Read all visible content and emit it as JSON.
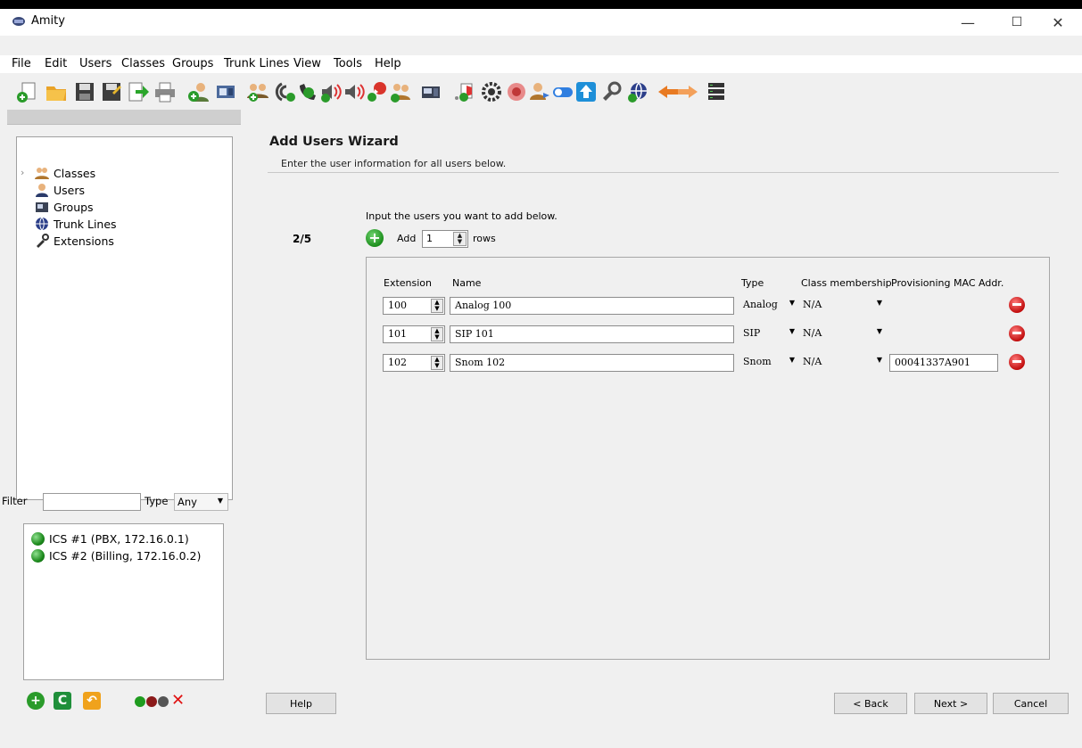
{
  "window": {
    "title": "Amity",
    "controls": [
      "—",
      "☐",
      "✕"
    ]
  },
  "menu": [
    {
      "label": "File"
    },
    {
      "label": "Edit"
    },
    {
      "label": "Users"
    },
    {
      "label": "Classes"
    },
    {
      "label": "Groups"
    },
    {
      "label": "Trunk Lines"
    },
    {
      "label": "View"
    },
    {
      "label": "Tools"
    },
    {
      "label": "Help"
    }
  ],
  "tree": {
    "items": [
      {
        "label": "Classes",
        "icon": "classes-icon"
      },
      {
        "label": "Users",
        "icon": "user-icon"
      },
      {
        "label": "Groups",
        "icon": "groups-icon"
      },
      {
        "label": "Trunk Lines",
        "icon": "trunk-lines-icon"
      },
      {
        "label": "Extensions",
        "icon": "extensions-icon"
      }
    ]
  },
  "filter": {
    "label": "Filter",
    "value": "",
    "type_label": "Type",
    "type_value": "Any"
  },
  "servers": [
    {
      "label": "ICS #1 (PBX, 172.16.0.1)",
      "status": "online"
    },
    {
      "label": "ICS #2 (Billing, 172.16.0.2)",
      "status": "online"
    }
  ],
  "wizard": {
    "title": "Add Users Wizard",
    "subtitle": "Enter the user information for all users below.",
    "step": "2/5",
    "instruction": "Input the users you want to add below.",
    "add_label": "Add",
    "add_count": "1",
    "rows_label": "rows",
    "columns": {
      "extension": "Extension",
      "name": "Name",
      "type": "Type",
      "class": "Class membership",
      "mac": "Provisioning MAC Addr."
    },
    "users": [
      {
        "extension": "100",
        "name": "Analog 100",
        "type": "Analog",
        "class": "N/A",
        "mac": ""
      },
      {
        "extension": "101",
        "name": "SIP 101",
        "type": "SIP",
        "class": "N/A",
        "mac": ""
      },
      {
        "extension": "102",
        "name": "Snom 102",
        "type": "Snom",
        "class": "N/A",
        "mac": "00041337A901"
      }
    ]
  },
  "buttons": {
    "help": "Help",
    "back": "< Back",
    "next": "Next >",
    "cancel": "Cancel"
  },
  "colors": {
    "accent_green": "#1c8e1c",
    "remove_red": "#c10d0d"
  }
}
